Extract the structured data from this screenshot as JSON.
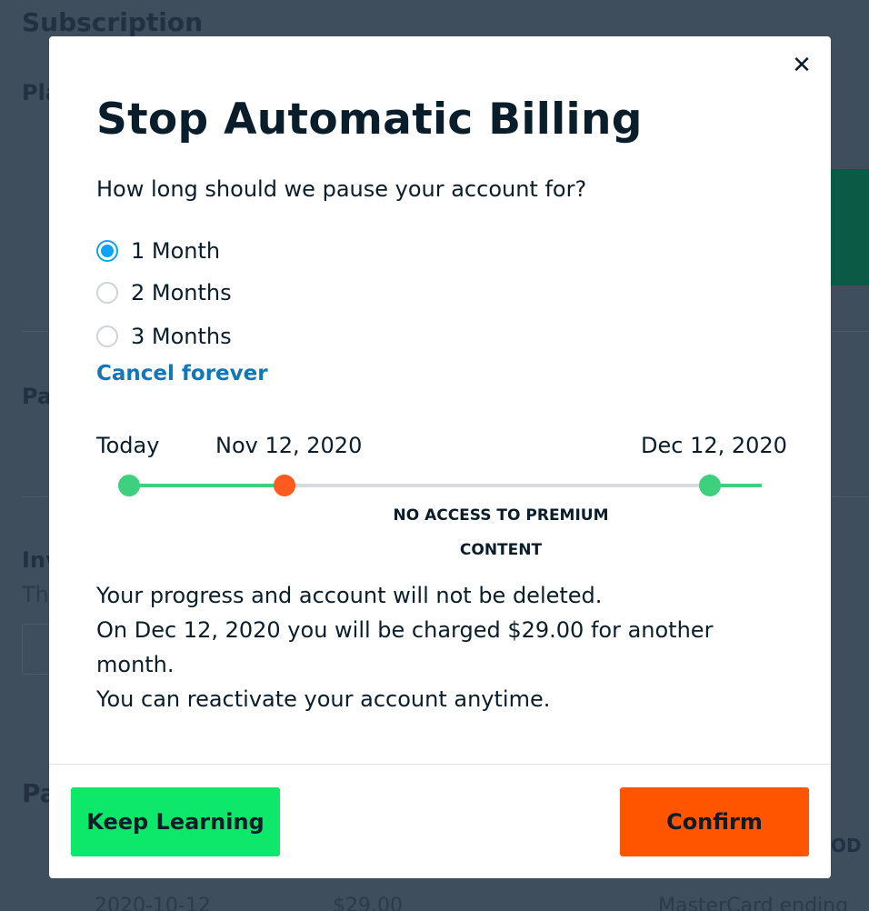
{
  "background": {
    "heading": "Subscription",
    "row1": "Pla",
    "row2": "Pa",
    "row3": "Inv",
    "row3_sub": "Th",
    "row4": "Pa",
    "table_col": "OD",
    "table_date": "2020-10-12",
    "table_amount": "$29.00",
    "table_method": "MasterCard ending"
  },
  "modal": {
    "close_icon": "close-icon",
    "title": "Stop Automatic Billing",
    "question": "How long should we pause your account for?",
    "options": [
      {
        "label": "1 Month",
        "selected": true
      },
      {
        "label": "2 Months",
        "selected": false
      },
      {
        "label": "3 Months",
        "selected": false
      }
    ],
    "cancel_link": "Cancel forever",
    "timeline": {
      "start_label": "Today",
      "pause_label": "Nov 12, 2020",
      "end_label": "Dec 12, 2020",
      "caption_line1": "NO ACCESS TO PREMIUM",
      "caption_line2": "CONTENT",
      "colors": {
        "active": "#3fd07f",
        "pause": "#ff5a1f",
        "inactive": "#d8dbde"
      }
    },
    "info_lines": [
      "Your progress and account will not be deleted.",
      "On Dec 12, 2020 you will be charged $29.00 for another month.",
      "You can reactivate your account anytime."
    ],
    "keep_button": "Keep Learning",
    "confirm_button": "Confirm"
  }
}
